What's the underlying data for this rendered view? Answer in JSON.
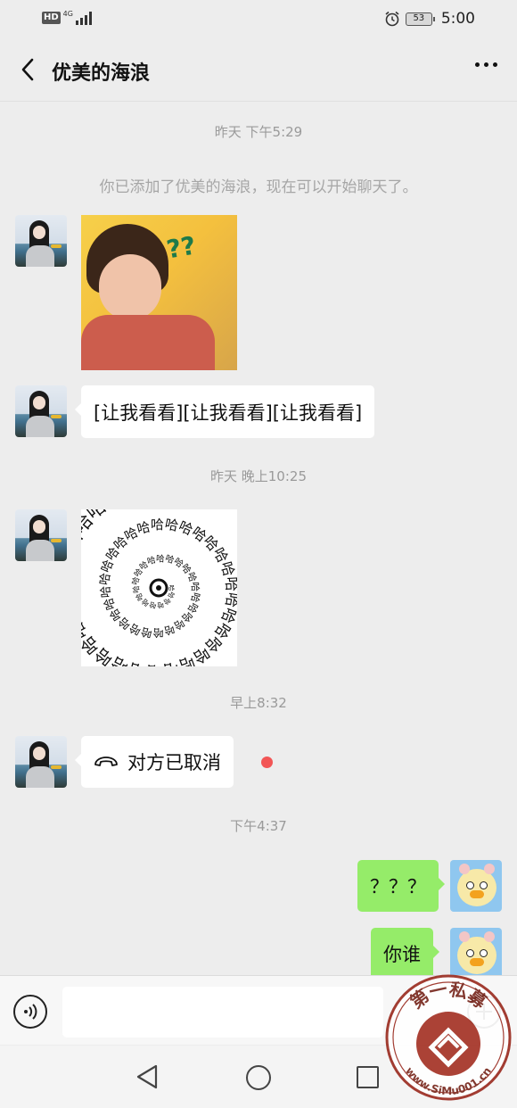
{
  "status_bar": {
    "hd": "HD",
    "network": "4G",
    "battery": "53",
    "time": "5:00",
    "icons": [
      "signal-icon",
      "alarm-icon",
      "battery-icon"
    ]
  },
  "header": {
    "title": "优美的海浪",
    "back_icon": "chevron-left-icon",
    "more_icon": "more-dots-icon"
  },
  "chat": {
    "timestamps": [
      "昨天 下午5:29",
      "昨天 晚上10:25",
      "早上8:32",
      "下午4:37"
    ],
    "system_message": "你已添加了优美的海浪，现在可以开始聊天了。",
    "messages": [
      {
        "from": "contact",
        "type": "image",
        "description_icon": "photo-sticker"
      },
      {
        "from": "contact",
        "type": "text",
        "text": "[让我看看][让我看看][让我看看]"
      },
      {
        "from": "contact",
        "type": "sticker",
        "sticker_char": "哈"
      },
      {
        "from": "contact",
        "type": "call",
        "text": "对方已取消"
      },
      {
        "from": "me",
        "type": "text",
        "text": "？？？"
      },
      {
        "from": "me",
        "type": "text",
        "text": "你谁"
      }
    ],
    "photo_overlay_text": "??"
  },
  "input_bar": {
    "placeholder": "",
    "voice_icon": "voice-icon",
    "plus_icon": "plus-icon"
  },
  "watermark": {
    "top": "第一私募",
    "bottom": "www.SiMu001.cn"
  },
  "colors": {
    "background": "#ededed",
    "bubble_me": "#95ec69",
    "bubble_contact": "#ffffff",
    "unread_dot": "#f25555",
    "watermark": "#b03a2e"
  }
}
